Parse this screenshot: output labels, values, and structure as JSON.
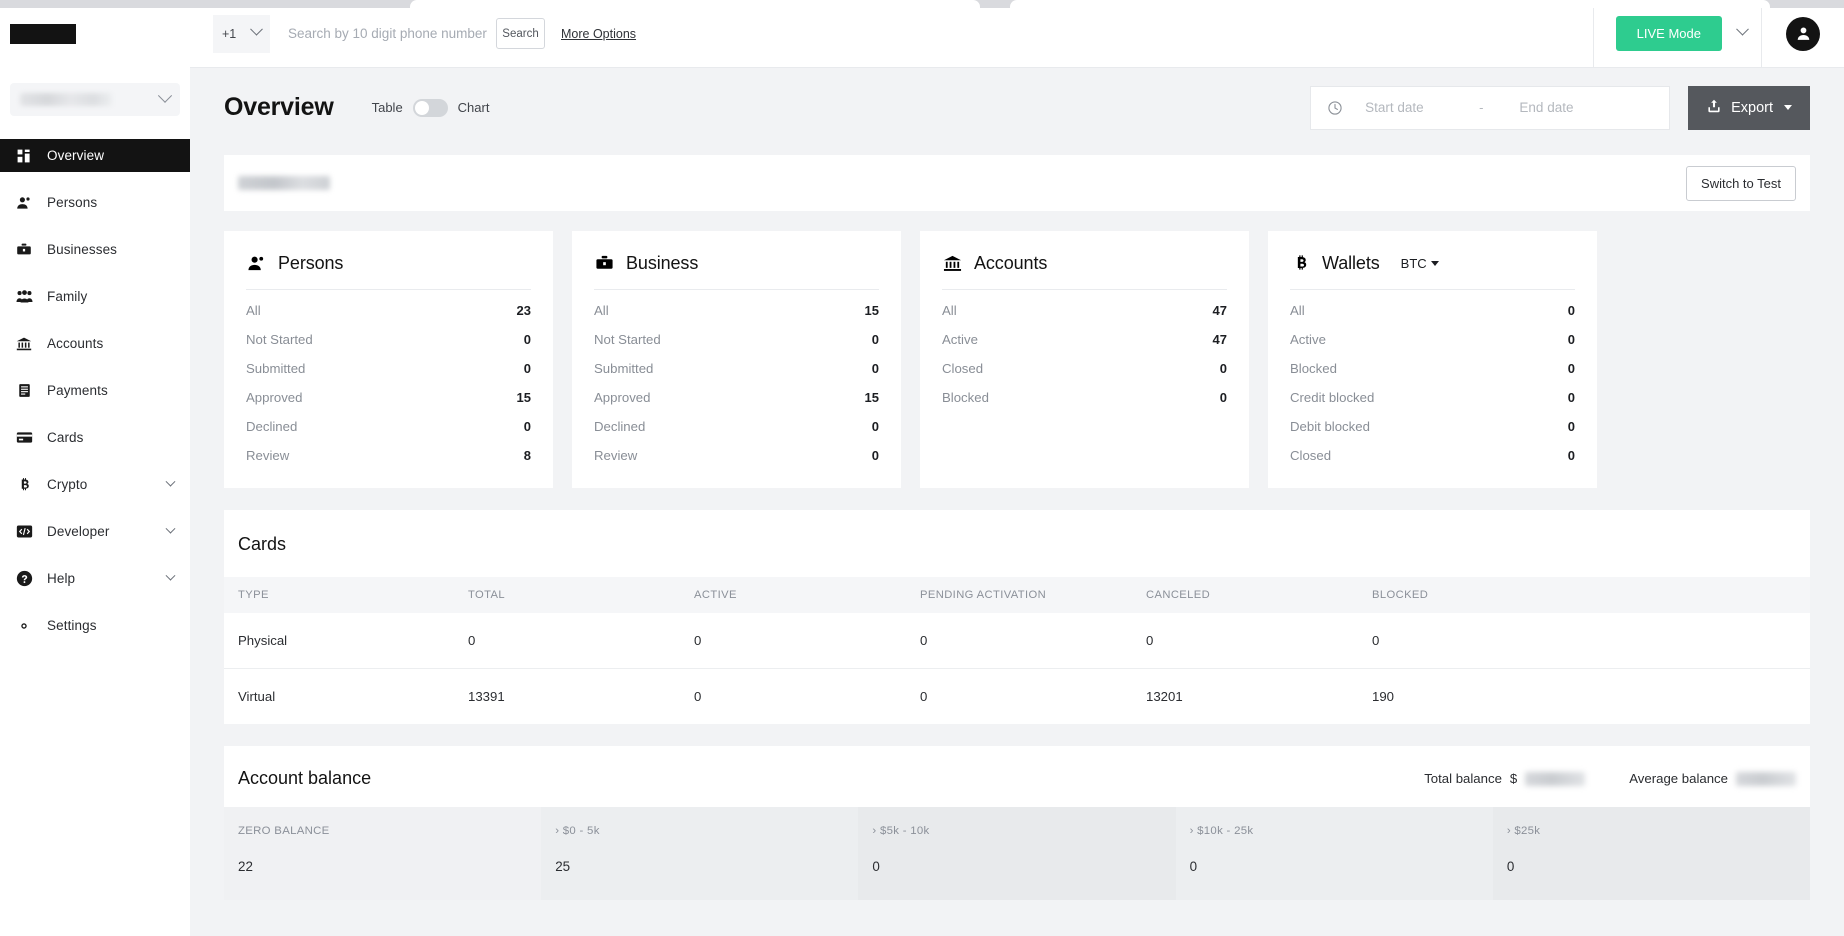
{
  "sidebar": {
    "org_selector_placeholder": "",
    "items": [
      {
        "label": "Overview",
        "icon": "grid-icon",
        "active": true,
        "expandable": false
      },
      {
        "label": "Persons",
        "icon": "person-icon",
        "active": false,
        "expandable": false
      },
      {
        "label": "Businesses",
        "icon": "briefcase-icon",
        "active": false,
        "expandable": false
      },
      {
        "label": "Family",
        "icon": "family-icon",
        "active": false,
        "expandable": false
      },
      {
        "label": "Accounts",
        "icon": "bank-icon",
        "active": false,
        "expandable": false
      },
      {
        "label": "Payments",
        "icon": "receipt-icon",
        "active": false,
        "expandable": false
      },
      {
        "label": "Cards",
        "icon": "card-icon",
        "active": false,
        "expandable": false
      },
      {
        "label": "Crypto",
        "icon": "bitcoin-icon",
        "active": false,
        "expandable": true
      },
      {
        "label": "Developer",
        "icon": "code-icon",
        "active": false,
        "expandable": true
      },
      {
        "label": "Help",
        "icon": "help-icon",
        "active": false,
        "expandable": true
      },
      {
        "label": "Settings",
        "icon": "gear-icon",
        "active": false,
        "expandable": false
      }
    ]
  },
  "topbar": {
    "country_code": "+1",
    "search_placeholder": "Search by 10 digit phone number",
    "search_value": "",
    "search_button": "Search",
    "more_options": "More Options",
    "mode_button": "LIVE Mode",
    "avatar_icon": "user-avatar-icon"
  },
  "header": {
    "title": "Overview",
    "toggle_left": "Table",
    "toggle_right": "Chart",
    "toggle_state": "Table",
    "start_date_placeholder": "Start date",
    "start_date_value": "",
    "end_date_placeholder": "End date",
    "end_date_value": "",
    "range_separator": "-",
    "export_label": "Export",
    "clock_icon": "clock-icon",
    "export_icon": "upload-icon"
  },
  "env_bar": {
    "switch_label": "Switch to Test"
  },
  "stat_cards": [
    {
      "title": "Persons",
      "icon": "person-icon",
      "rows": [
        {
          "label": "All",
          "value": "23"
        },
        {
          "label": "Not Started",
          "value": "0"
        },
        {
          "label": "Submitted",
          "value": "0"
        },
        {
          "label": "Approved",
          "value": "15"
        },
        {
          "label": "Declined",
          "value": "0"
        },
        {
          "label": "Review",
          "value": "8"
        }
      ]
    },
    {
      "title": "Business",
      "icon": "briefcase-icon",
      "rows": [
        {
          "label": "All",
          "value": "15"
        },
        {
          "label": "Not Started",
          "value": "0"
        },
        {
          "label": "Submitted",
          "value": "0"
        },
        {
          "label": "Approved",
          "value": "15"
        },
        {
          "label": "Declined",
          "value": "0"
        },
        {
          "label": "Review",
          "value": "0"
        }
      ]
    },
    {
      "title": "Accounts",
      "icon": "bank-icon",
      "rows": [
        {
          "label": "All",
          "value": "47"
        },
        {
          "label": "Active",
          "value": "47"
        },
        {
          "label": "Closed",
          "value": "0"
        },
        {
          "label": "Blocked",
          "value": "0"
        }
      ]
    },
    {
      "title": "Wallets",
      "icon": "bitcoin-icon",
      "currency": "BTC",
      "rows": [
        {
          "label": "All",
          "value": "0"
        },
        {
          "label": "Active",
          "value": "0"
        },
        {
          "label": "Blocked",
          "value": "0"
        },
        {
          "label": "Credit blocked",
          "value": "0"
        },
        {
          "label": "Debit blocked",
          "value": "0"
        },
        {
          "label": "Closed",
          "value": "0"
        }
      ]
    }
  ],
  "cards_section": {
    "title": "Cards",
    "columns": [
      "TYPE",
      "TOTAL",
      "ACTIVE",
      "PENDING ACTIVATION",
      "CANCELED",
      "BLOCKED"
    ],
    "rows": [
      {
        "type": "Physical",
        "total": "0",
        "active": "0",
        "pending": "0",
        "canceled": "0",
        "blocked": "0"
      },
      {
        "type": "Virtual",
        "total": "13391",
        "active": "0",
        "pending": "0",
        "canceled": "13201",
        "blocked": "190"
      }
    ]
  },
  "account_balance": {
    "title": "Account balance",
    "total_balance_label": "Total balance",
    "total_balance_prefix": "$",
    "average_balance_label": "Average balance",
    "buckets": [
      {
        "label": "ZERO BALANCE",
        "value": "22"
      },
      {
        "label": "› $0 - 5k",
        "value": "25"
      },
      {
        "label": "› $5k - 10k",
        "value": "0"
      },
      {
        "label": "› $10k - 25k",
        "value": "0"
      },
      {
        "label": "› $25k",
        "value": "0"
      }
    ]
  },
  "colors": {
    "accent_green": "#2ecc8f",
    "sidebar_active": "#131313",
    "export_gray": "#55585d",
    "page_bg": "#f2f3f5"
  }
}
